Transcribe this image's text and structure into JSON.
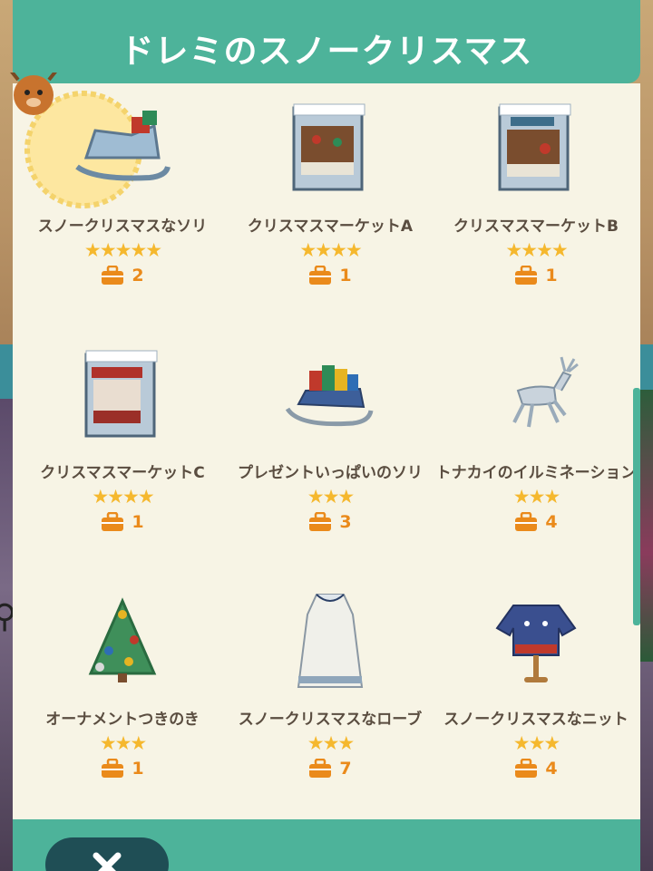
{
  "dialog": {
    "title": "ドレミのスノークリスマス"
  },
  "items": [
    {
      "name": "スノークリスマスなソリ",
      "stars": "★★★★★",
      "count": "2",
      "icon": "sleigh-icon",
      "featured": true
    },
    {
      "name": "クリスマスマーケットA",
      "stars": "★★★★",
      "count": "1",
      "icon": "market-stall-icon"
    },
    {
      "name": "クリスマスマーケットB",
      "stars": "★★★★",
      "count": "1",
      "icon": "market-stall-icon"
    },
    {
      "name": "クリスマスマーケットC",
      "stars": "★★★★",
      "count": "1",
      "icon": "market-stall-icon"
    },
    {
      "name": "プレゼントいっぱいのソリ",
      "stars": "★★★",
      "count": "3",
      "icon": "present-sleigh-icon"
    },
    {
      "name": "トナカイのイルミネーション",
      "stars": "★★★",
      "count": "4",
      "icon": "reindeer-icon"
    },
    {
      "name": "オーナメントつきのき",
      "stars": "★★★",
      "count": "1",
      "icon": "christmas-tree-icon"
    },
    {
      "name": "スノークリスマスなローブ",
      "stars": "★★★",
      "count": "7",
      "icon": "robe-icon"
    },
    {
      "name": "スノークリスマスなニット",
      "stars": "★★★",
      "count": "4",
      "icon": "sweater-icon"
    }
  ],
  "colors": {
    "accent": "#4db39a",
    "panel": "#f7f4e5",
    "star": "#f5b82e",
    "count": "#ea8a1b",
    "text": "#5a4d40",
    "close_button": "#1f4e55"
  }
}
